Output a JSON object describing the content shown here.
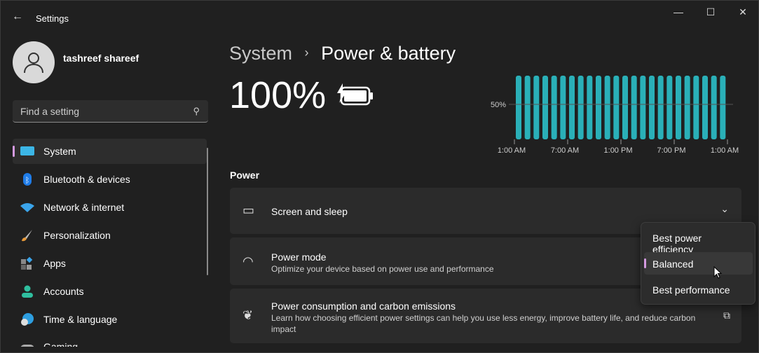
{
  "window": {
    "title": "Settings"
  },
  "user": {
    "name": "tashreef shareef"
  },
  "search": {
    "placeholder": "Find a setting"
  },
  "sidebar": {
    "items": [
      {
        "label": "System",
        "icon": "monitor-icon",
        "selected": true
      },
      {
        "label": "Bluetooth & devices",
        "icon": "bluetooth-icon"
      },
      {
        "label": "Network & internet",
        "icon": "wifi-icon"
      },
      {
        "label": "Personalization",
        "icon": "brush-icon"
      },
      {
        "label": "Apps",
        "icon": "apps-icon"
      },
      {
        "label": "Accounts",
        "icon": "person-icon"
      },
      {
        "label": "Time & language",
        "icon": "globe-clock-icon"
      },
      {
        "label": "Gaming",
        "icon": "gamepad-icon"
      }
    ]
  },
  "breadcrumb": {
    "parent": "System",
    "sep": "›",
    "current": "Power & battery"
  },
  "battery": {
    "percent": "100%"
  },
  "chart_data": {
    "type": "bar",
    "ytick": "50%",
    "ylim": [
      0,
      100
    ],
    "xticks": [
      "1:00 AM",
      "7:00 AM",
      "1:00 PM",
      "7:00 PM",
      "1:00 AM"
    ],
    "values": [
      100,
      100,
      100,
      100,
      100,
      100,
      100,
      100,
      100,
      100,
      100,
      100,
      100,
      100,
      100,
      100,
      100,
      100,
      100,
      100,
      100,
      100,
      100,
      100
    ],
    "color": "#2ab0b8"
  },
  "power": {
    "section": "Power",
    "screen_sleep": {
      "title": "Screen and sleep"
    },
    "power_mode": {
      "title": "Power mode",
      "desc": "Optimize your device based on power use and performance"
    },
    "carbon": {
      "title": "Power consumption and carbon emissions",
      "desc": "Learn how choosing efficient power settings can help you use less energy, improve battery life, and reduce carbon impact"
    }
  },
  "power_mode_menu": {
    "options": [
      "Best power efficiency",
      "Balanced",
      "Best performance"
    ],
    "selected": "Balanced"
  },
  "accent": "#d49ae0"
}
